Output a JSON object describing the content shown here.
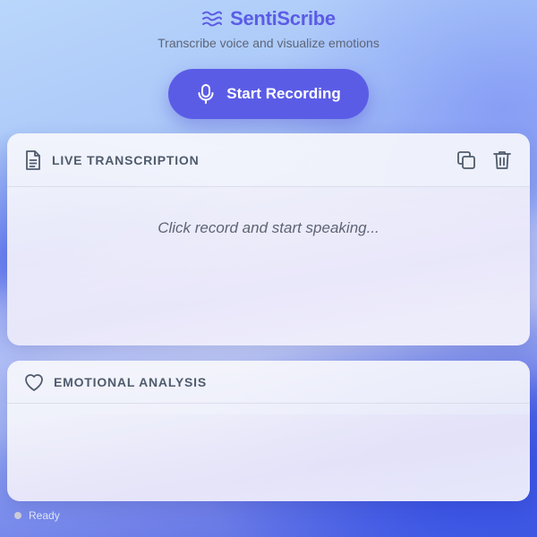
{
  "app": {
    "title": "SentiScribe",
    "tagline": "Transcribe voice and visualize emotions",
    "brand_icon": "waves-icon",
    "accent_color": "#5b5ce6"
  },
  "record_button": {
    "label": "Start Recording",
    "icon": "microphone-icon"
  },
  "transcription": {
    "title": "LIVE TRANSCRIPTION",
    "icon": "document-icon",
    "placeholder": "Click record and start speaking...",
    "actions": [
      {
        "name": "copy",
        "icon": "copy-icon"
      },
      {
        "name": "delete",
        "icon": "trash-icon"
      }
    ]
  },
  "emotional_analysis": {
    "title": "EMOTIONAL ANALYSIS",
    "icon": "heart-icon"
  },
  "status": {
    "text": "Ready",
    "dot_color": "#c9ccd6"
  }
}
